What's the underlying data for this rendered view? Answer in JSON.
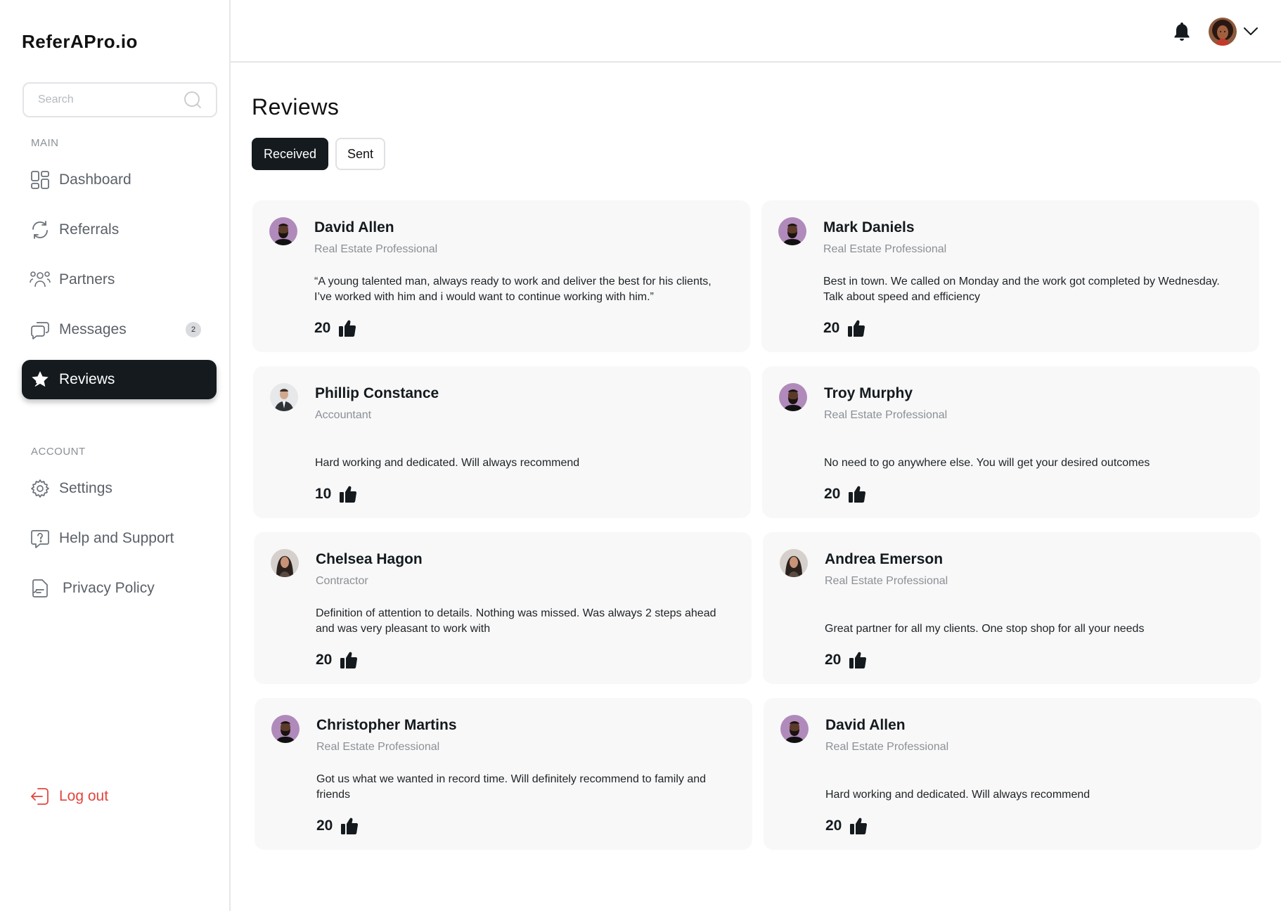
{
  "app": {
    "brand": "ReferAPro.io"
  },
  "search": {
    "placeholder": "Search"
  },
  "sidebar": {
    "main_label": "MAIN",
    "account_label": "ACCOUNT",
    "items": [
      {
        "label": "Dashboard",
        "icon": "dashboard-icon"
      },
      {
        "label": "Referrals",
        "icon": "refresh-icon"
      },
      {
        "label": "Partners",
        "icon": "partners-icon"
      },
      {
        "label": "Messages",
        "icon": "chat-icon",
        "badge": "2"
      },
      {
        "label": "Reviews",
        "icon": "star-icon",
        "active": true
      }
    ],
    "account_items": [
      {
        "label": "Settings",
        "icon": "gear-icon"
      },
      {
        "label": "Help and Support",
        "icon": "help-icon"
      },
      {
        "label": "Privacy Policy",
        "icon": "document-icon"
      }
    ],
    "logout": "Log out"
  },
  "header": {
    "bell": "bell-icon",
    "avatar": "user-avatar"
  },
  "main": {
    "title": "Reviews",
    "tabs": [
      {
        "label": "Received",
        "active": true
      },
      {
        "label": "Sent",
        "active": false
      }
    ],
    "reviews": [
      {
        "name": "David Allen",
        "role": "Real Estate Professional",
        "text": "“A young talented man, always ready to work and deliver the best for his clients, I’ve worked with him and i would want to continue working with him.”",
        "likes": "20",
        "avatar": "bearded-man"
      },
      {
        "name": "Mark Daniels",
        "role": "Real Estate Professional",
        "text": "Best in town. We called on Monday and the work got completed by Wednesday. Talk about speed and efficiency",
        "likes": "20",
        "avatar": "bearded-man"
      },
      {
        "name": "Phillip Constance",
        "role": "Accountant",
        "text": "Hard working and dedicated. Will always recommend",
        "likes": "10",
        "avatar": "suited-man"
      },
      {
        "name": "Troy Murphy",
        "role": "Real Estate Professional",
        "text": "No need to go anywhere else. You will get your desired outcomes",
        "likes": "20",
        "avatar": "bearded-man"
      },
      {
        "name": "Chelsea Hagon",
        "role": "Contractor",
        "text": "Definition of attention to details. Nothing was missed. Was always 2 steps ahead and was very pleasant to work with",
        "likes": "20",
        "avatar": "woman"
      },
      {
        "name": "Andrea Emerson",
        "role": "Real Estate Professional",
        "text": "Great partner for all my clients. One stop shop for all your needs",
        "likes": "20",
        "avatar": "woman"
      },
      {
        "name": "Christopher Martins",
        "role": "Real Estate Professional",
        "text": "Got us what we wanted in record time. Will definitely recommend to family and friends",
        "likes": "20",
        "avatar": "bearded-man"
      },
      {
        "name": "David Allen",
        "role": "Real Estate Professional",
        "text": "Hard working and dedicated. Will always recommend",
        "likes": "20",
        "avatar": "bearded-man"
      }
    ]
  },
  "colors": {
    "accent": "#141a1e",
    "danger": "#e2453c",
    "card_bg": "#f8f8f8"
  }
}
